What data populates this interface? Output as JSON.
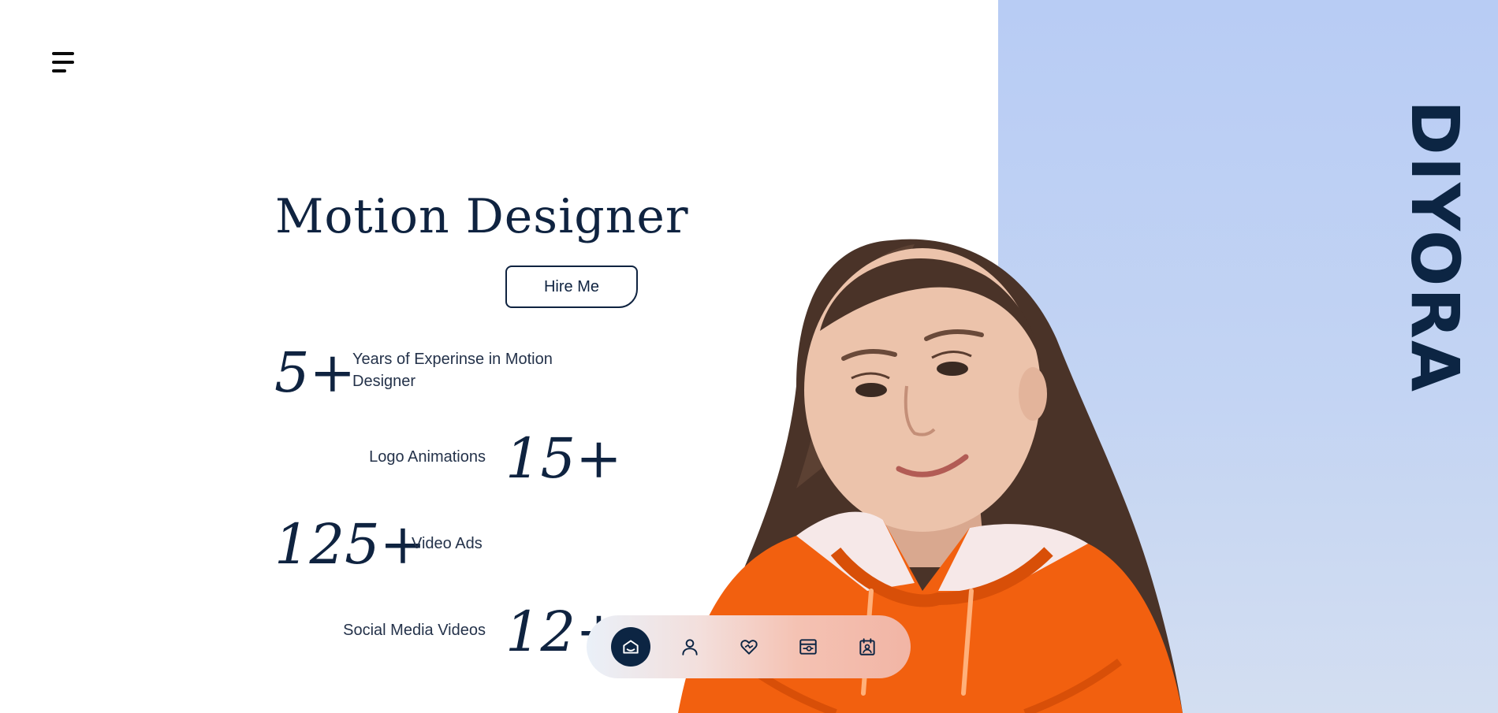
{
  "brand": {
    "name": "DIYORA"
  },
  "hero": {
    "title": "Motion Designer",
    "hire_button": "Hire Me"
  },
  "stats": [
    {
      "number": "5+",
      "label": "Years of Experinse in Motion Designer"
    },
    {
      "number": "15+",
      "label": "Logo Animations"
    },
    {
      "number": "125+",
      "label": "Video Ads"
    },
    {
      "number": "12+",
      "label": "Social Media Videos"
    }
  ],
  "nav": {
    "items": [
      {
        "icon": "home-icon",
        "active": true
      },
      {
        "icon": "user-icon",
        "active": false
      },
      {
        "icon": "heart-icon",
        "active": false
      },
      {
        "icon": "portfolio-icon",
        "active": false
      },
      {
        "icon": "contact-icon",
        "active": false
      }
    ]
  },
  "colors": {
    "navy": "#0c2543",
    "panel": "#b8ccf4",
    "hoodie": "#f2600f"
  }
}
